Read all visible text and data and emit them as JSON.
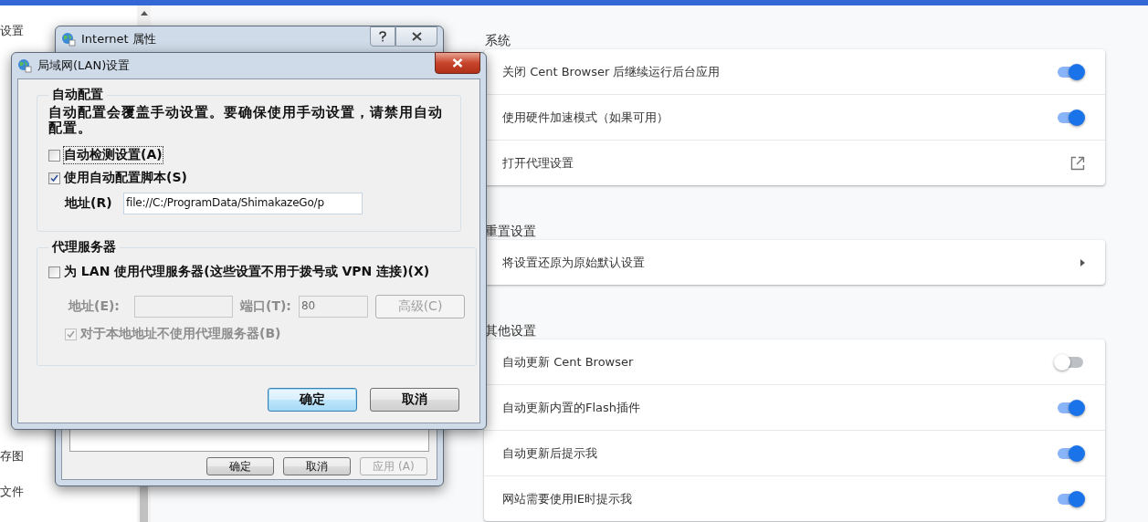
{
  "sidebar": {
    "items": [
      {
        "label": "设置"
      },
      {
        "label": "存图"
      },
      {
        "label": "文件"
      }
    ]
  },
  "sections": [
    {
      "title": "系统",
      "rows": [
        {
          "kind": "toggle",
          "label": "关闭 Cent Browser 后继续运行后台应用",
          "on": true
        },
        {
          "kind": "toggle",
          "label": "使用硬件加速模式（如果可用）",
          "on": true
        },
        {
          "kind": "link",
          "label": "打开代理设置"
        }
      ]
    },
    {
      "title": "重置设置",
      "rows": [
        {
          "kind": "arrow",
          "label": "将设置还原为原始默认设置"
        }
      ]
    },
    {
      "title": "其他设置",
      "rows": [
        {
          "kind": "toggle",
          "label": "自动更新 Cent Browser",
          "on": false
        },
        {
          "kind": "toggle",
          "label": "自动更新内置的Flash插件",
          "on": true
        },
        {
          "kind": "toggle",
          "label": "自动更新后提示我",
          "on": true
        },
        {
          "kind": "toggle",
          "label": "网站需要使用IE时提示我",
          "on": true
        }
      ]
    }
  ],
  "internet_options": {
    "title": "Internet 属性",
    "buttons": [
      {
        "label": "确定",
        "disabled": false
      },
      {
        "label": "取消",
        "disabled": false
      },
      {
        "label": "应用 (A)",
        "disabled": true
      }
    ]
  },
  "lan_dialog": {
    "title": "局域网(LAN)设置",
    "auto_config": {
      "title": "自动配置",
      "description": "自动配置会覆盖手动设置。要确保使用手动设置，请禁用自动配置。",
      "options": [
        {
          "label": "自动检测设置(A)",
          "checked": false,
          "focused": true
        },
        {
          "label": "使用自动配置脚本(S)",
          "checked": true,
          "focused": false
        }
      ],
      "address": {
        "label": "地址(R)",
        "value": "file://C:/ProgramData/ShimakazeGo/p"
      }
    },
    "proxy": {
      "title": "代理服务器",
      "use_proxy": {
        "label": "为 LAN 使用代理服务器(这些设置不用于拨号或 VPN 连接)(X)",
        "checked": false
      },
      "disabled": true,
      "address": {
        "label": "地址(E):"
      },
      "port": {
        "label": "端口(T):",
        "value": "80"
      },
      "advanced": {
        "label": "高级(C)"
      },
      "bypass": {
        "label": "对于本地地址不使用代理服务器(B)",
        "checked": true
      }
    },
    "buttons": [
      {
        "label": "确定",
        "focused": true
      },
      {
        "label": "取消",
        "focused": false
      }
    ]
  }
}
